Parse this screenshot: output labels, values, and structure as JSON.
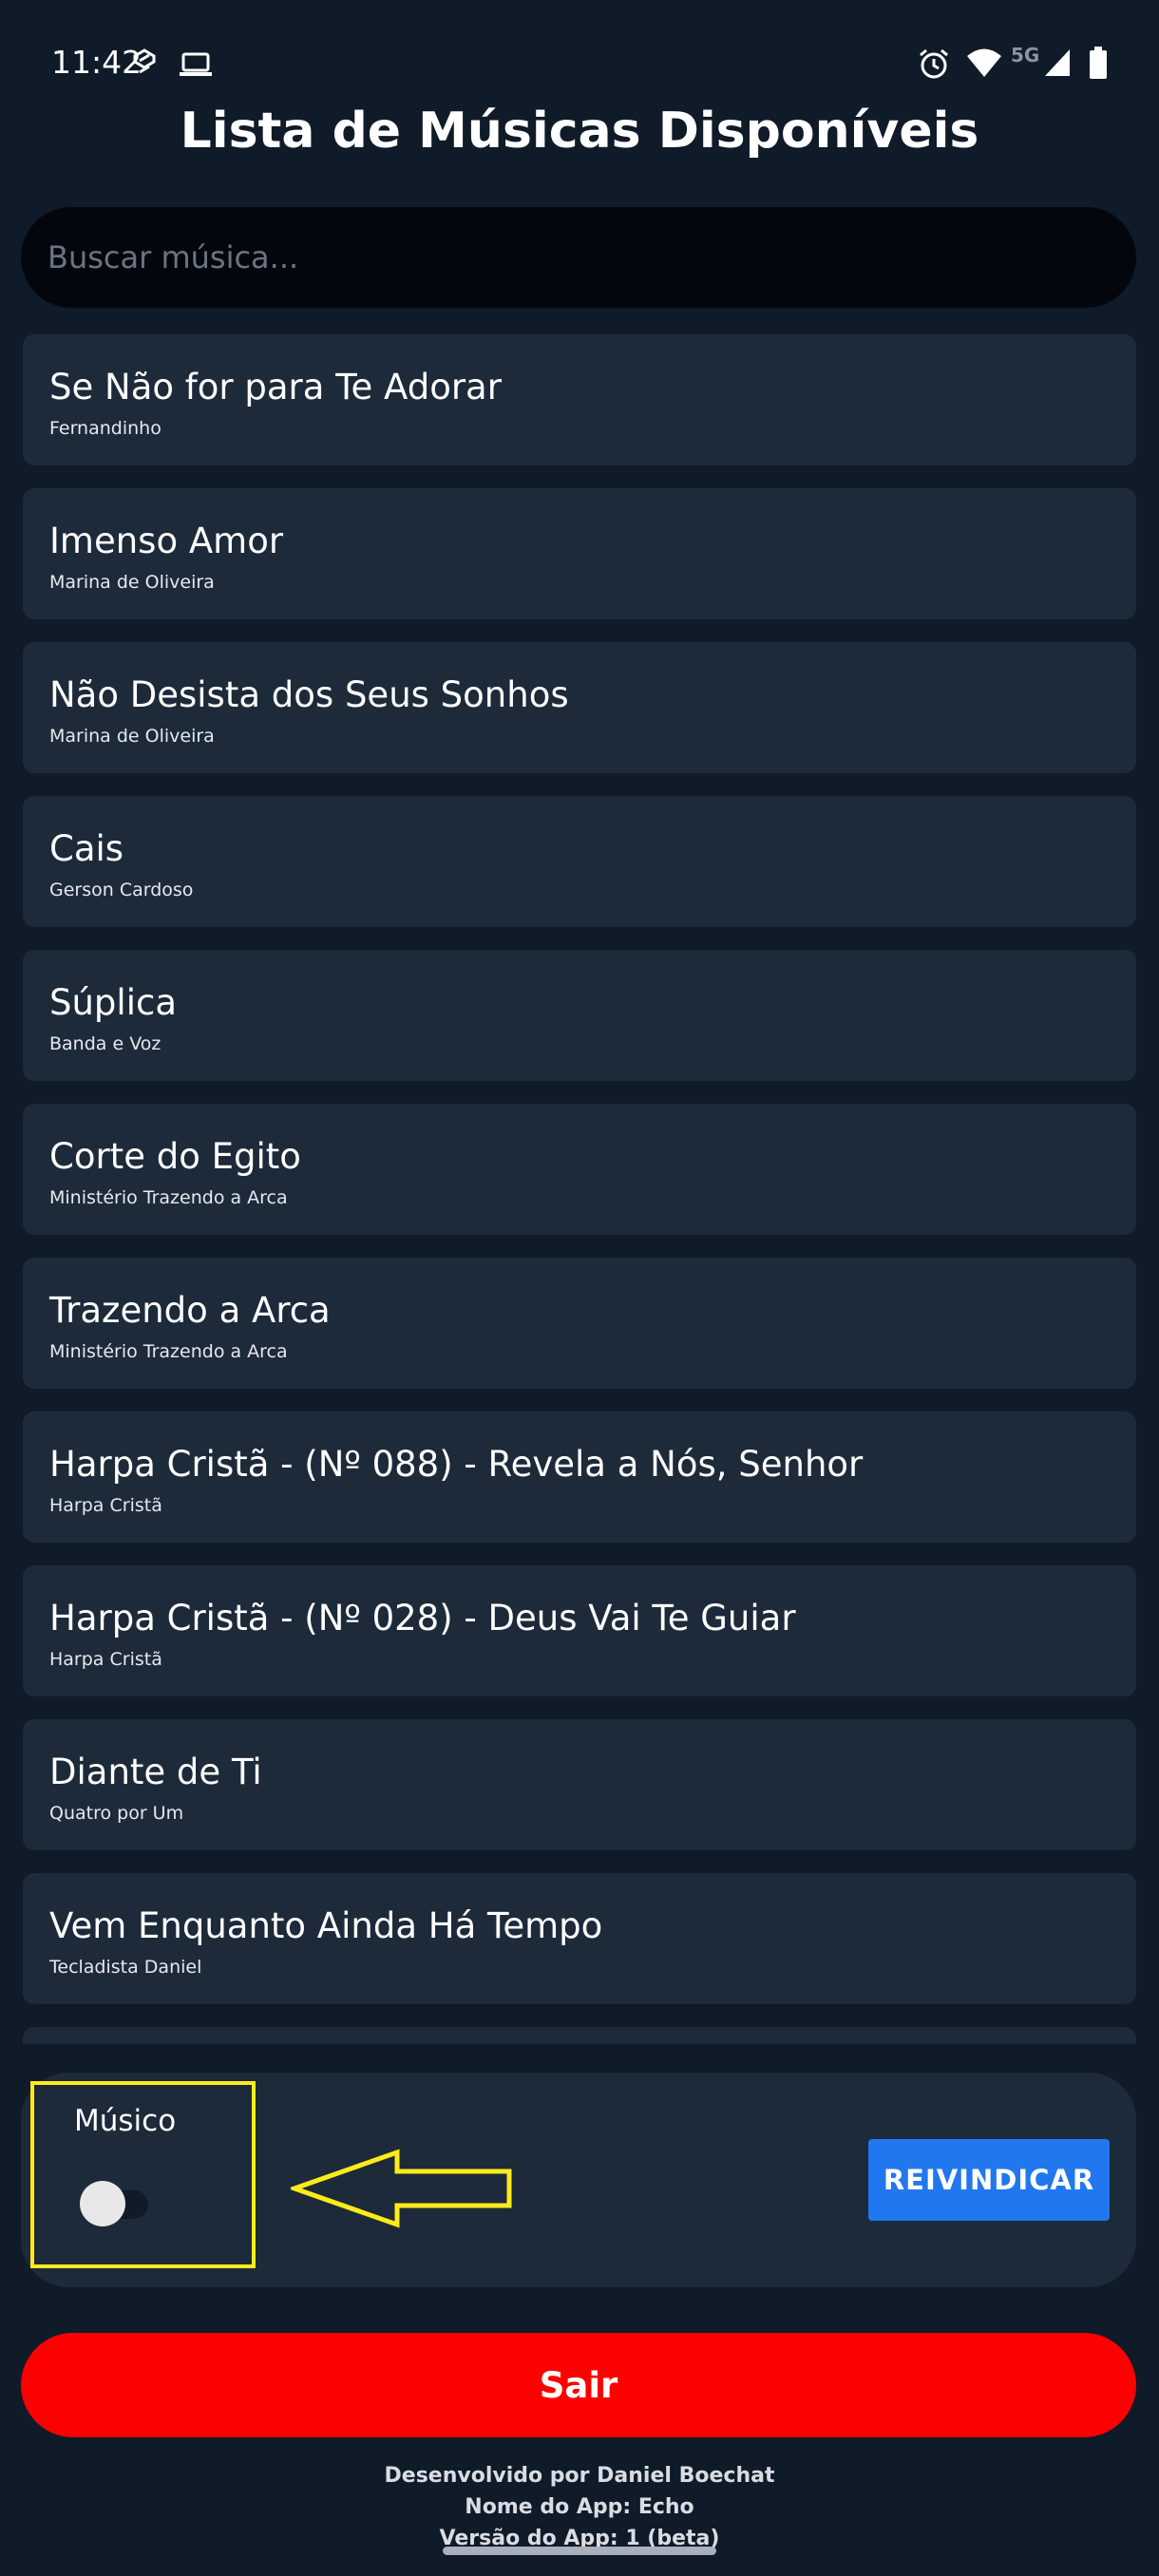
{
  "status_bar": {
    "time": "11:42",
    "network": "5G",
    "icons": [
      "sync-icon",
      "laptop-icon",
      "alarm-icon",
      "wifi-icon",
      "signal-icon",
      "battery-icon"
    ]
  },
  "header": {
    "title": "Lista de Músicas Disponíveis"
  },
  "search": {
    "placeholder": "Buscar música...",
    "value": ""
  },
  "songs": [
    {
      "title": "Se Não for para Te Adorar",
      "artist": "Fernandinho"
    },
    {
      "title": "Imenso Amor",
      "artist": "Marina de Oliveira"
    },
    {
      "title": "Não Desista dos Seus Sonhos",
      "artist": "Marina de Oliveira"
    },
    {
      "title": "Cais",
      "artist": "Gerson Cardoso"
    },
    {
      "title": "Súplica",
      "artist": "Banda e Voz"
    },
    {
      "title": "Corte do Egito",
      "artist": "Ministério Trazendo a Arca"
    },
    {
      "title": "Trazendo a Arca",
      "artist": "Ministério Trazendo a Arca"
    },
    {
      "title": "Harpa Cristã - (Nº 088) - Revela a Nós, Senhor",
      "artist": "Harpa Cristã"
    },
    {
      "title": "Harpa Cristã - (Nº 028) - Deus Vai Te Guiar",
      "artist": "Harpa Cristã"
    },
    {
      "title": "Diante de Ti",
      "artist": "Quatro por Um"
    },
    {
      "title": "Vem Enquanto Ainda Há Tempo",
      "artist": "Tecladista Daniel"
    }
  ],
  "panel": {
    "musico_label": "Músico",
    "musico_toggle_on": false,
    "claim_label": "REIVINDICAR"
  },
  "exit_label": "Sair",
  "footer": {
    "developer": "Desenvolvido por Daniel Boechat",
    "app_name": "Nome do App: Echo",
    "app_version": "Versão do App: 1 (beta)"
  },
  "colors": {
    "background": "#0f1b29",
    "card": "#1d2a3a",
    "accent_blue": "#2178ee",
    "exit_red": "#fd0100",
    "highlight_yellow": "#ffeb1a"
  }
}
